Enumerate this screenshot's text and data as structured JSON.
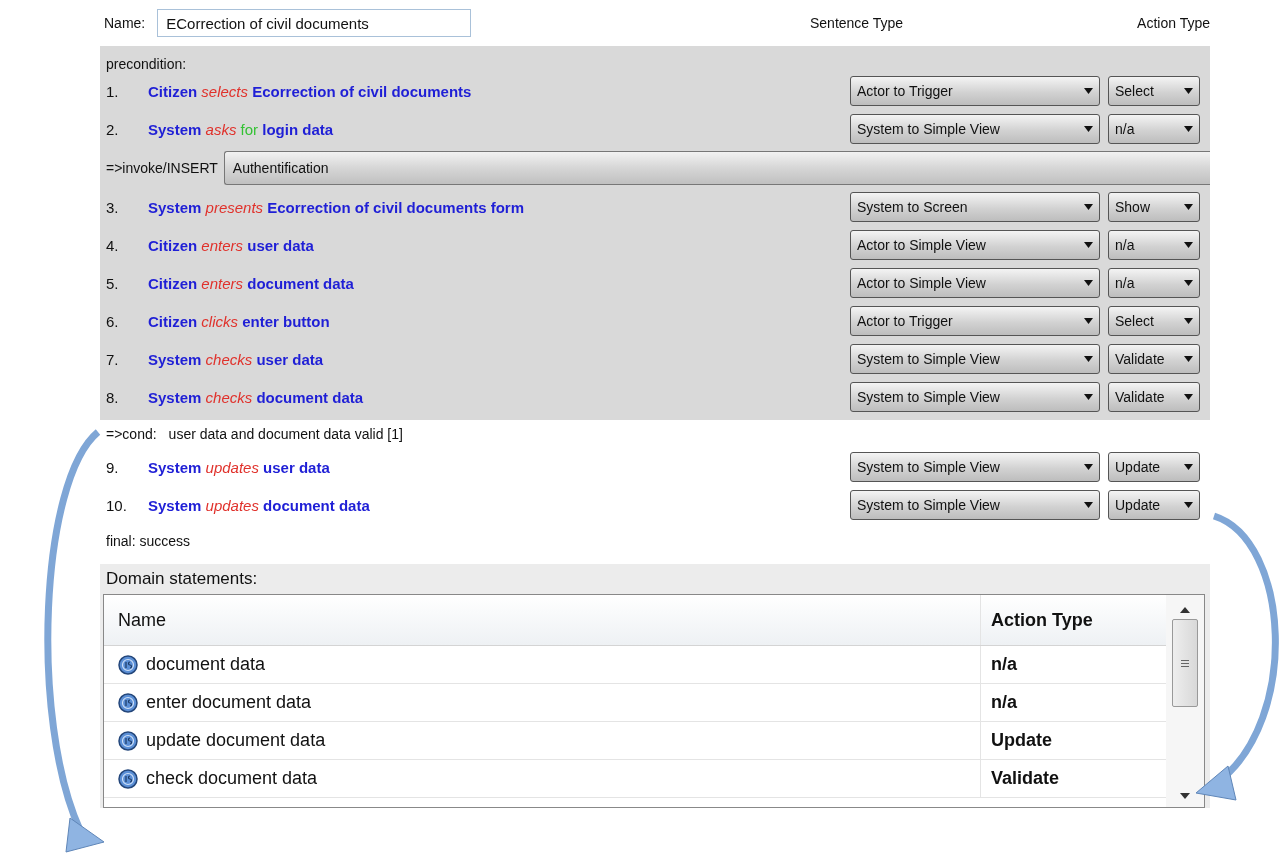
{
  "name_field": {
    "label": "Name:",
    "value": "ECorrection of civil documents"
  },
  "column_headers": {
    "sentence_type": "Sentence Type",
    "action_type": "Action Type"
  },
  "sections": [
    {
      "shaded": true,
      "items": [
        {
          "kind": "label",
          "text": "precondition:"
        },
        {
          "kind": "step",
          "number": "1.",
          "parts": [
            {
              "text": "Citizen",
              "kind": "subject"
            },
            {
              "text": "selects",
              "kind": "verb"
            },
            {
              "text": "Ecorrection of civil documents",
              "kind": "object"
            }
          ],
          "sentence_type": "Actor to Trigger",
          "action_type": "Select"
        },
        {
          "kind": "step",
          "number": "2.",
          "parts": [
            {
              "text": "System",
              "kind": "subject"
            },
            {
              "text": "asks",
              "kind": "verb"
            },
            {
              "text": "for",
              "kind": "preposition"
            },
            {
              "text": "login data",
              "kind": "object"
            }
          ],
          "sentence_type": "System to Simple View",
          "action_type": "n/a"
        },
        {
          "kind": "invoke",
          "label": "=>invoke/INSERT",
          "value": "Authentification"
        },
        {
          "kind": "step",
          "number": "3.",
          "parts": [
            {
              "text": "System",
              "kind": "subject"
            },
            {
              "text": "presents",
              "kind": "verb"
            },
            {
              "text": "Ecorrection of civil documents form",
              "kind": "object"
            }
          ],
          "sentence_type": "System to Screen",
          "action_type": "Show"
        },
        {
          "kind": "step",
          "number": "4.",
          "parts": [
            {
              "text": "Citizen",
              "kind": "subject"
            },
            {
              "text": "enters",
              "kind": "verb"
            },
            {
              "text": "user data",
              "kind": "object"
            }
          ],
          "sentence_type": "Actor to Simple View",
          "action_type": "n/a"
        },
        {
          "kind": "step",
          "number": "5.",
          "parts": [
            {
              "text": "Citizen",
              "kind": "subject"
            },
            {
              "text": "enters",
              "kind": "verb"
            },
            {
              "text": "document data",
              "kind": "object"
            }
          ],
          "sentence_type": "Actor to Simple View",
          "action_type": "n/a"
        },
        {
          "kind": "step",
          "number": "6.",
          "parts": [
            {
              "text": "Citizen",
              "kind": "subject"
            },
            {
              "text": "clicks",
              "kind": "verb"
            },
            {
              "text": "enter button",
              "kind": "object"
            }
          ],
          "sentence_type": "Actor to Trigger",
          "action_type": "Select"
        },
        {
          "kind": "step",
          "number": "7.",
          "parts": [
            {
              "text": "System",
              "kind": "subject"
            },
            {
              "text": "checks",
              "kind": "verb"
            },
            {
              "text": "user data",
              "kind": "object"
            }
          ],
          "sentence_type": "System to Simple View",
          "action_type": "Validate"
        },
        {
          "kind": "step",
          "number": "8.",
          "parts": [
            {
              "text": "System",
              "kind": "subject"
            },
            {
              "text": "checks",
              "kind": "verb"
            },
            {
              "text": "document data",
              "kind": "object"
            }
          ],
          "sentence_type": "System to Simple View",
          "action_type": "Validate"
        }
      ]
    },
    {
      "shaded": false,
      "items": [
        {
          "kind": "cond",
          "label": "=>cond:",
          "text": "user data and document data valid [1]"
        },
        {
          "kind": "step",
          "number": "9.",
          "parts": [
            {
              "text": "System",
              "kind": "subject"
            },
            {
              "text": "updates",
              "kind": "verb"
            },
            {
              "text": "user data",
              "kind": "object"
            }
          ],
          "sentence_type": "System to Simple View",
          "action_type": "Update"
        },
        {
          "kind": "step",
          "number": "10.",
          "parts": [
            {
              "text": "System",
              "kind": "subject"
            },
            {
              "text": "updates",
              "kind": "verb"
            },
            {
              "text": "document data",
              "kind": "object"
            }
          ],
          "sentence_type": "System to Simple View",
          "action_type": "Update"
        },
        {
          "kind": "label",
          "text": "final: success"
        }
      ]
    }
  ],
  "domain_statements": {
    "title": "Domain statements:",
    "columns": [
      "Name",
      "Action Type"
    ],
    "rows": [
      {
        "name": "document data",
        "action_type": "n/a"
      },
      {
        "name": "enter document data",
        "action_type": "n/a"
      },
      {
        "name": "update document data",
        "action_type": "Update"
      },
      {
        "name": "check document data",
        "action_type": "Validate"
      }
    ]
  }
}
